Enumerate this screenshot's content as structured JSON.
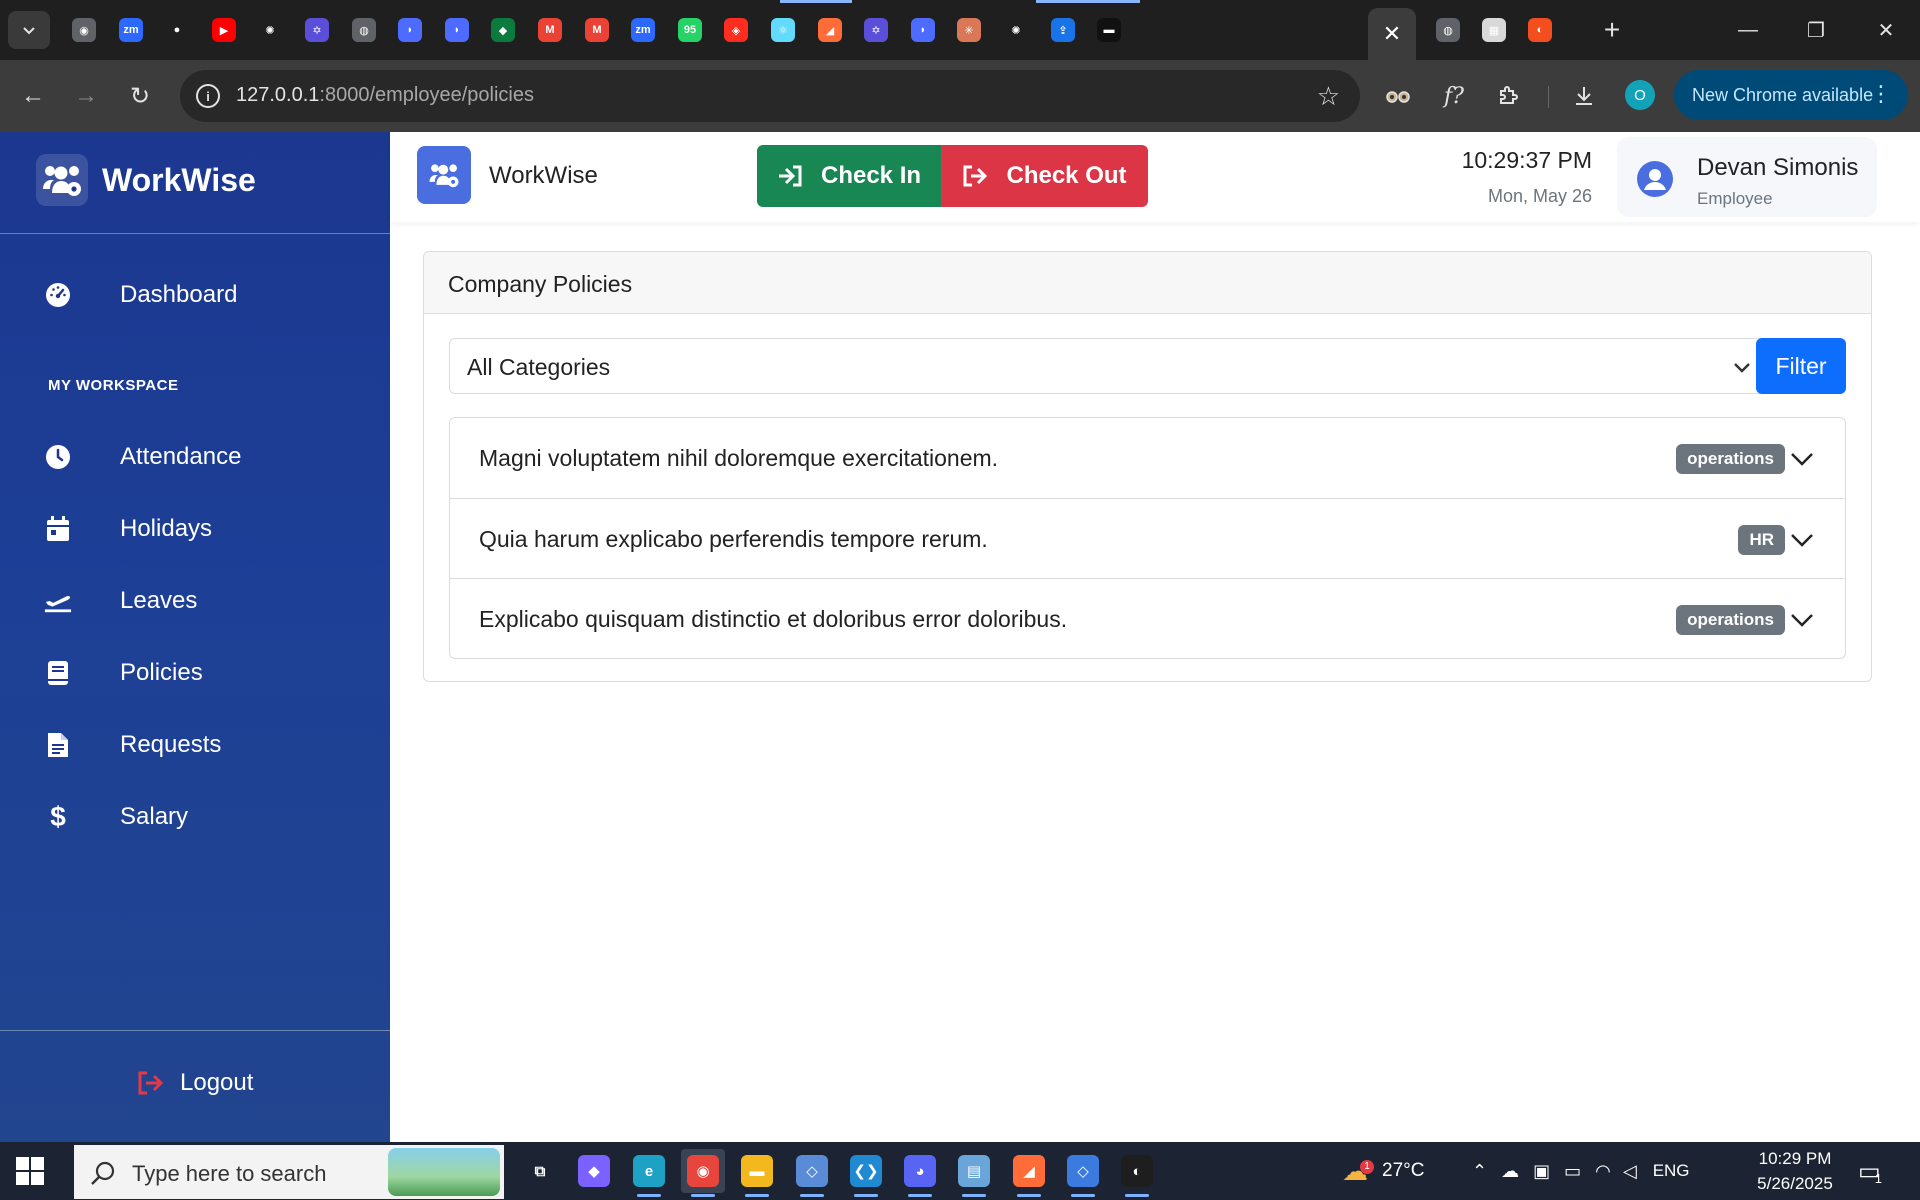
{
  "browser": {
    "url_host": "127.0.0.1",
    "url_path": ":8000/employee/policies",
    "update_label": "New Chrome available",
    "profile_initial": "O",
    "tab_search_icon": "chevron-down-icon",
    "tab_favicons": [
      {
        "name": "chrome-favicon",
        "color": "#5f6368",
        "glyph": "◉"
      },
      {
        "name": "zoom-favicon",
        "color": "#2d68ff",
        "glyph": "zm"
      },
      {
        "name": "github-favicon",
        "color": "#1f1f1f",
        "glyph": "●"
      },
      {
        "name": "youtube-favicon",
        "color": "#ff0000",
        "glyph": "▶"
      },
      {
        "name": "openai-favicon",
        "color": "#1f1f1f",
        "glyph": "✺"
      },
      {
        "name": "linear-favicon",
        "color": "#5b4fd9",
        "glyph": "✡"
      },
      {
        "name": "globe-favicon",
        "color": "#5f6368",
        "glyph": "◍"
      },
      {
        "name": "deepseek-favicon",
        "color": "#4d6bfe",
        "glyph": "◗"
      },
      {
        "name": "deepseek-favicon-2",
        "color": "#4d6bfe",
        "glyph": "◗"
      },
      {
        "name": "mongodb-favicon",
        "color": "#0b7a3e",
        "glyph": "◆"
      },
      {
        "name": "gmail-favicon",
        "color": "#ea4335",
        "glyph": "M"
      },
      {
        "name": "gmail-favicon-2",
        "color": "#ea4335",
        "glyph": "M"
      },
      {
        "name": "zoom-favicon-2",
        "color": "#2d68ff",
        "glyph": "zm"
      },
      {
        "name": "whatsapp-favicon",
        "color": "#25d366",
        "glyph": "95"
      },
      {
        "name": "laravel-favicon",
        "color": "#ff2d20",
        "glyph": "◈"
      },
      {
        "name": "react-favicon",
        "color": "#61dafb",
        "glyph": "⚛"
      },
      {
        "name": "postman-favicon",
        "color": "#ff6c37",
        "glyph": "◢"
      },
      {
        "name": "linear-favicon-2",
        "color": "#5b4fd9",
        "glyph": "✡"
      },
      {
        "name": "deepseek-favicon-3",
        "color": "#4d6bfe",
        "glyph": "◗"
      },
      {
        "name": "claude-favicon",
        "color": "#d97757",
        "glyph": "✳"
      },
      {
        "name": "openai-favicon-2",
        "color": "#1f1f1f",
        "glyph": "✺"
      },
      {
        "name": "share-favicon",
        "color": "#1a73e8",
        "glyph": "⇪"
      },
      {
        "name": "terminal-favicon",
        "color": "#111111",
        "glyph": "▬"
      }
    ],
    "tab_favicons_after": [
      {
        "name": "globe-favicon-2",
        "color": "#5f6368",
        "glyph": "◍"
      },
      {
        "name": "photo-favicon",
        "color": "#d9d9d9",
        "glyph": "▦"
      },
      {
        "name": "figma-favicon",
        "color": "#f24e1e",
        "glyph": "◐"
      }
    ]
  },
  "sidebar": {
    "brand": "WorkWise",
    "section_label": "MY WORKSPACE",
    "items": [
      {
        "label": "Dashboard",
        "icon": "gauge-icon"
      },
      {
        "label": "Attendance",
        "icon": "clock-icon"
      },
      {
        "label": "Holidays",
        "icon": "calendar-icon"
      },
      {
        "label": "Leaves",
        "icon": "plane-icon"
      },
      {
        "label": "Policies",
        "icon": "book-icon"
      },
      {
        "label": "Requests",
        "icon": "file-icon"
      },
      {
        "label": "Salary",
        "icon": "dollar-icon"
      }
    ],
    "logout_label": "Logout"
  },
  "header": {
    "app_name": "WorkWise",
    "check_in_label": "Check In",
    "check_out_label": "Check Out",
    "time": "10:29:37 PM",
    "date": "Mon, May 26",
    "user_name": "Devan Simonis",
    "user_role": "Employee"
  },
  "policies": {
    "title": "Company Policies",
    "category_selected": "All Categories",
    "filter_label": "Filter",
    "items": [
      {
        "title": "Magni voluptatem nihil doloremque exercitationem.",
        "category": "operations"
      },
      {
        "title": "Quia harum explicabo perferendis tempore rerum.",
        "category": "HR"
      },
      {
        "title": "Explicabo quisquam distinctio et doloribus error doloribus.",
        "category": "operations"
      }
    ]
  },
  "taskbar": {
    "search_placeholder": "Type here to search",
    "weather": "27°C",
    "weather_badge": "1",
    "language": "ENG",
    "clock_time": "10:29 PM",
    "clock_date": "5/26/2025",
    "notification_count": "1",
    "apps": [
      {
        "name": "task-view-icon",
        "color": "#1c2433",
        "glyph": "⧉"
      },
      {
        "name": "copilot-icon",
        "color": "#7b61ff",
        "glyph": "◆"
      },
      {
        "name": "edge-icon",
        "color": "#1da1c4",
        "glyph": "e"
      },
      {
        "name": "chrome-icon",
        "color": "#e8453c",
        "glyph": "◉"
      },
      {
        "name": "file-explorer-icon",
        "color": "#f2b81d",
        "glyph": "▬"
      },
      {
        "name": "git-tool-icon",
        "color": "#5a8bd6",
        "glyph": "◇"
      },
      {
        "name": "vscode-icon",
        "color": "#1f8ad2",
        "glyph": "❮❯"
      },
      {
        "name": "discord-icon",
        "color": "#5865f2",
        "glyph": "◕"
      },
      {
        "name": "notepad-icon",
        "color": "#6aa5d9",
        "glyph": "▤"
      },
      {
        "name": "postman-icon",
        "color": "#ff6c37",
        "glyph": "◢"
      },
      {
        "name": "sourcetree-icon",
        "color": "#3b7be0",
        "glyph": "◇"
      },
      {
        "name": "figma-icon",
        "color": "#1e1e1e",
        "glyph": "◐"
      }
    ]
  },
  "colors": {
    "sidebar_bg": "#1c3790",
    "check_in": "#198754",
    "check_out": "#dc3545",
    "primary": "#0d6efd",
    "badge": "#6c757d",
    "brand_logo_bg": "#4a6ee0"
  }
}
